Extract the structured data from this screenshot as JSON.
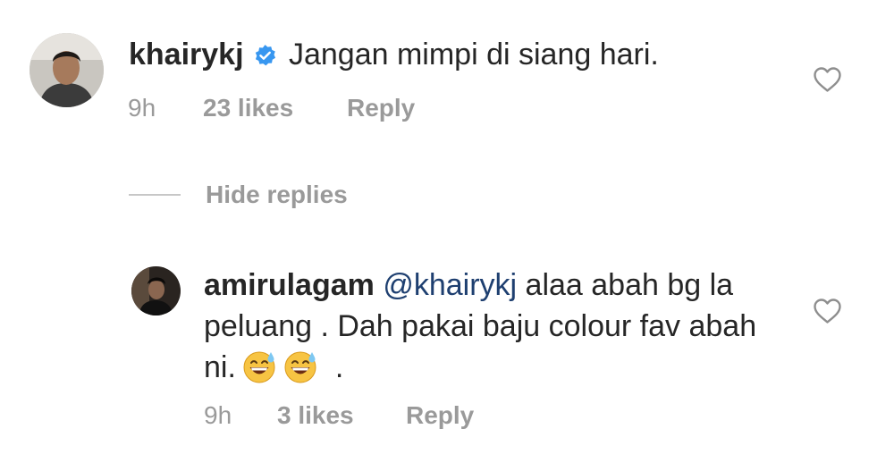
{
  "comment": {
    "username": "khairykj",
    "text": "Jangan mimpi di siang hari.",
    "time": "9h",
    "likes": "23 likes",
    "reply_label": "Reply"
  },
  "hide_replies_label": "Hide replies",
  "reply": {
    "username": "amirulagam",
    "mention": "@khairykj",
    "text": "alaa abah bg la peluang . Dah pakai baju colour fav abah ni.",
    "trailing": ".",
    "time": "9h",
    "likes": "3 likes",
    "reply_label": "Reply"
  },
  "colors": {
    "text": "#262626",
    "meta": "#9a9a9a",
    "mention": "#1e3f70",
    "verified": "#3897f0",
    "divider": "#c7c7c7"
  },
  "icons": {
    "verified": "verified-badge-icon",
    "like": "heart-icon",
    "emoji": "grinning-sweat-emoji"
  }
}
